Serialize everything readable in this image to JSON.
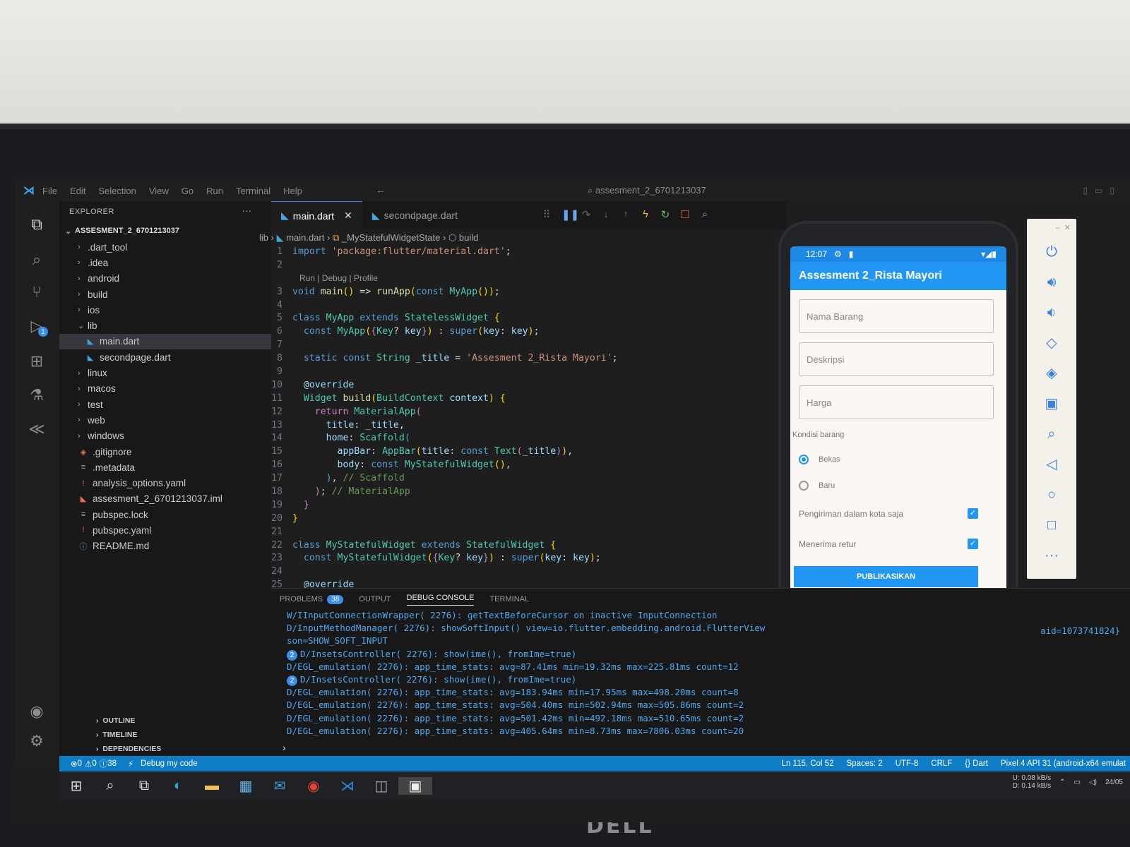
{
  "menubar": {
    "items": [
      "File",
      "Edit",
      "Selection",
      "View",
      "Go",
      "Run",
      "Terminal",
      "Help"
    ],
    "search_title": "assesment_2_6701213037"
  },
  "explorer": {
    "header": "EXPLORER",
    "project": "ASSESMENT_2_6701213037",
    "tree": [
      {
        "label": ".dart_tool",
        "type": "folder",
        "indent": 1
      },
      {
        "label": ".idea",
        "type": "folder",
        "indent": 1
      },
      {
        "label": "android",
        "type": "folder",
        "indent": 1
      },
      {
        "label": "build",
        "type": "folder",
        "indent": 1
      },
      {
        "label": "ios",
        "type": "folder",
        "indent": 1
      },
      {
        "label": "lib",
        "type": "folder-open",
        "indent": 1
      },
      {
        "label": "main.dart",
        "type": "dart",
        "indent": 2,
        "active": true
      },
      {
        "label": "secondpage.dart",
        "type": "dart",
        "indent": 2
      },
      {
        "label": "linux",
        "type": "folder",
        "indent": 1
      },
      {
        "label": "macos",
        "type": "folder",
        "indent": 1
      },
      {
        "label": "test",
        "type": "folder",
        "indent": 1
      },
      {
        "label": "web",
        "type": "folder",
        "indent": 1
      },
      {
        "label": "windows",
        "type": "folder",
        "indent": 1
      },
      {
        "label": ".gitignore",
        "type": "git",
        "indent": 1
      },
      {
        "label": ".metadata",
        "type": "lines",
        "indent": 1
      },
      {
        "label": "analysis_options.yaml",
        "type": "yaml",
        "indent": 1
      },
      {
        "label": "assesment_2_6701213037.iml",
        "type": "iml",
        "indent": 1
      },
      {
        "label": "pubspec.lock",
        "type": "lines",
        "indent": 1
      },
      {
        "label": "pubspec.yaml",
        "type": "yaml",
        "indent": 1
      },
      {
        "label": "README.md",
        "type": "info",
        "indent": 1
      }
    ],
    "outline": "OUTLINE",
    "timeline": "TIMELINE",
    "dependencies": "DEPENDENCIES"
  },
  "editor": {
    "tabs": [
      {
        "label": "main.dart",
        "active": true
      },
      {
        "label": "secondpage.dart",
        "active": false
      }
    ],
    "breadcrumb": [
      "lib",
      "main.dart",
      "_MyStatefulWidgetState",
      "build"
    ],
    "codelens": "Run | Debug | Profile",
    "lines": [
      {
        "n": "1",
        "tokens": [
          [
            "kw",
            "import "
          ],
          [
            "str",
            "'package:flutter/material.dart'"
          ],
          [
            "pl",
            ";"
          ]
        ]
      },
      {
        "n": "2",
        "tokens": []
      },
      {
        "lens": true
      },
      {
        "n": "3",
        "tokens": [
          [
            "kw",
            "void "
          ],
          [
            "fn",
            "main"
          ],
          [
            "br",
            "()"
          ],
          [
            "pl",
            " => "
          ],
          [
            "fn",
            "runApp"
          ],
          [
            "br",
            "("
          ],
          [
            "kw",
            "const "
          ],
          [
            "cls",
            "MyApp"
          ],
          [
            "br",
            "()"
          ],
          [
            "br",
            ")"
          ],
          [
            "pl",
            ";"
          ]
        ]
      },
      {
        "n": "4",
        "tokens": []
      },
      {
        "n": "5",
        "tokens": [
          [
            "kw",
            "class "
          ],
          [
            "cls",
            "MyApp "
          ],
          [
            "kw",
            "extends "
          ],
          [
            "cls",
            "StatelessWidget "
          ],
          [
            "br",
            "{"
          ]
        ]
      },
      {
        "n": "6",
        "tokens": [
          [
            "pl",
            "  "
          ],
          [
            "kw",
            "const "
          ],
          [
            "cls",
            "MyApp"
          ],
          [
            "br",
            "("
          ],
          [
            "ctl",
            "{"
          ],
          [
            "cls",
            "Key"
          ],
          [
            "pl",
            "? "
          ],
          [
            "prm",
            "key"
          ],
          [
            "ctl",
            "}"
          ],
          [
            "br",
            ")"
          ],
          [
            "pl",
            " : "
          ],
          [
            "kw",
            "super"
          ],
          [
            "br",
            "("
          ],
          [
            "prm",
            "key"
          ],
          [
            "pl",
            ": "
          ],
          [
            "prm",
            "key"
          ],
          [
            "br",
            ")"
          ],
          [
            "pl",
            ";"
          ]
        ]
      },
      {
        "n": "7",
        "tokens": []
      },
      {
        "n": "8",
        "tokens": [
          [
            "pl",
            "  "
          ],
          [
            "kw",
            "static const "
          ],
          [
            "cls",
            "String "
          ],
          [
            "prm",
            "_title"
          ],
          [
            "pl",
            " = "
          ],
          [
            "str",
            "'Assesment 2_Rista Mayori'"
          ],
          [
            "pl",
            ";"
          ]
        ]
      },
      {
        "n": "9",
        "tokens": []
      },
      {
        "n": "10",
        "tokens": [
          [
            "pl",
            "  "
          ],
          [
            "ann",
            "@override"
          ]
        ]
      },
      {
        "n": "11",
        "tokens": [
          [
            "pl",
            "  "
          ],
          [
            "cls",
            "Widget "
          ],
          [
            "fn",
            "build"
          ],
          [
            "br",
            "("
          ],
          [
            "cls",
            "BuildContext "
          ],
          [
            "prm",
            "context"
          ],
          [
            "br",
            ")"
          ],
          [
            "pl",
            " "
          ],
          [
            "br",
            "{"
          ]
        ]
      },
      {
        "n": "12",
        "tokens": [
          [
            "pl",
            "    "
          ],
          [
            "ctl",
            "return "
          ],
          [
            "cls",
            "MaterialApp"
          ],
          [
            "ctl",
            "("
          ]
        ]
      },
      {
        "n": "13",
        "tokens": [
          [
            "pl",
            "      "
          ],
          [
            "prm",
            "title"
          ],
          [
            "pl",
            ": "
          ],
          [
            "prm",
            "_title"
          ],
          [
            "pl",
            ","
          ]
        ]
      },
      {
        "n": "14",
        "tokens": [
          [
            "pl",
            "      "
          ],
          [
            "prm",
            "home"
          ],
          [
            "pl",
            ": "
          ],
          [
            "cls",
            "Scaffold"
          ],
          [
            "kw",
            "("
          ]
        ]
      },
      {
        "n": "15",
        "tokens": [
          [
            "pl",
            "        "
          ],
          [
            "prm",
            "appBar"
          ],
          [
            "pl",
            ": "
          ],
          [
            "cls",
            "AppBar"
          ],
          [
            "br",
            "("
          ],
          [
            "prm",
            "title"
          ],
          [
            "pl",
            ": "
          ],
          [
            "kw",
            "const "
          ],
          [
            "cls",
            "Text"
          ],
          [
            "ctl",
            "("
          ],
          [
            "prm",
            "_title"
          ],
          [
            "ctl",
            ")"
          ],
          [
            "br",
            ")"
          ],
          [
            "pl",
            ","
          ]
        ]
      },
      {
        "n": "16",
        "tokens": [
          [
            "pl",
            "        "
          ],
          [
            "prm",
            "body"
          ],
          [
            "pl",
            ": "
          ],
          [
            "kw",
            "const "
          ],
          [
            "cls",
            "MyStatefulWidget"
          ],
          [
            "br",
            "()"
          ],
          [
            "pl",
            ","
          ]
        ]
      },
      {
        "n": "17",
        "tokens": [
          [
            "pl",
            "      "
          ],
          [
            "kw",
            ")"
          ],
          [
            "pl",
            ", "
          ],
          [
            "cmt",
            "// Scaffold"
          ]
        ]
      },
      {
        "n": "18",
        "tokens": [
          [
            "pl",
            "    "
          ],
          [
            "ctl",
            ")"
          ],
          [
            "pl",
            "; "
          ],
          [
            "cmt",
            "// MaterialApp"
          ]
        ]
      },
      {
        "n": "19",
        "tokens": [
          [
            "pl",
            "  "
          ],
          [
            "ctl",
            "}"
          ]
        ]
      },
      {
        "n": "20",
        "tokens": [
          [
            "br",
            "}"
          ]
        ]
      },
      {
        "n": "21",
        "tokens": []
      },
      {
        "n": "22",
        "tokens": [
          [
            "kw",
            "class "
          ],
          [
            "cls",
            "MyStatefulWidget "
          ],
          [
            "kw",
            "extends "
          ],
          [
            "cls",
            "StatefulWidget "
          ],
          [
            "br",
            "{"
          ]
        ]
      },
      {
        "n": "23",
        "tokens": [
          [
            "pl",
            "  "
          ],
          [
            "kw",
            "const "
          ],
          [
            "cls",
            "MyStatefulWidget"
          ],
          [
            "br",
            "("
          ],
          [
            "ctl",
            "{"
          ],
          [
            "cls",
            "Key"
          ],
          [
            "pl",
            "? "
          ],
          [
            "prm",
            "key"
          ],
          [
            "ctl",
            "}"
          ],
          [
            "br",
            ")"
          ],
          [
            "pl",
            " : "
          ],
          [
            "kw",
            "super"
          ],
          [
            "br",
            "("
          ],
          [
            "prm",
            "key"
          ],
          [
            "pl",
            ": "
          ],
          [
            "prm",
            "key"
          ],
          [
            "br",
            ")"
          ],
          [
            "pl",
            ";"
          ]
        ]
      },
      {
        "n": "24",
        "tokens": []
      },
      {
        "n": "25",
        "tokens": [
          [
            "pl",
            "  "
          ],
          [
            "ann",
            "@override"
          ]
        ]
      }
    ]
  },
  "panel": {
    "tabs": [
      "PROBLEMS",
      "OUTPUT",
      "DEBUG CONSOLE",
      "TERMINAL"
    ],
    "problems_count": "38",
    "console": [
      {
        "text": "W/IInputConnectionWrapper( 2276): getTextBeforeCursor on inactive InputConnection"
      },
      {
        "text": "D/InputMethodManager( 2276): showSoftInput() view=io.flutter.embedding.android.FlutterView"
      },
      {
        "text": "son=SHOW_SOFT_INPUT"
      },
      {
        "rep": "2",
        "text": "D/InsetsController( 2276): show(ime(), fromIme=true)"
      },
      {
        "text": "D/EGL_emulation( 2276): app_time_stats: avg=87.41ms min=19.32ms max=225.81ms count=12"
      },
      {
        "rep": "2",
        "text": "D/InsetsController( 2276): show(ime(), fromIme=true)"
      },
      {
        "text": "D/EGL_emulation( 2276): app_time_stats: avg=183.94ms min=17.95ms max=498.20ms count=8"
      },
      {
        "text": "D/EGL_emulation( 2276): app_time_stats: avg=504.40ms min=502.94ms max=505.86ms count=2"
      },
      {
        "text": "D/EGL_emulation( 2276): app_time_stats: avg=501.42ms min=492.18ms max=510.65ms count=2"
      },
      {
        "text": "D/EGL_emulation( 2276): app_time_stats: avg=405.64ms min=8.73ms max=7806.03ms count=20"
      }
    ],
    "console_right": "aid=1073741824}"
  },
  "statusbar": {
    "errors": "0",
    "warnings": "0",
    "infos": "38",
    "debug": "Debug my code",
    "position": "Ln 115, Col 52",
    "spaces": "Spaces: 2",
    "encoding": "UTF-8",
    "eol": "CRLF",
    "language": "Dart",
    "device": "Pixel 4 API 31 (android-x64 emulat"
  },
  "tray": {
    "net_up": "0.08 kB/s",
    "net_down": "0.14 kB/s",
    "date": "24/05"
  },
  "phone": {
    "time": "12:07",
    "app_title": "Assesment 2_Rista Mayori",
    "fields": [
      "Nama Barang",
      "Deskripsi",
      "Harga"
    ],
    "section_label": "Kondisi barang",
    "radios": [
      {
        "label": "Bekas",
        "selected": true
      },
      {
        "label": "Baru",
        "selected": false
      }
    ],
    "checks": [
      {
        "label": "Pengiriman dalam kota saja",
        "checked": true
      },
      {
        "label": "Menerima retur",
        "checked": true
      }
    ],
    "button": "PUBLIKASIKAN"
  },
  "monitor_brand": "DELL",
  "colors": {
    "accent": "#3b8eea",
    "statusbar": "#0f7cc6",
    "appbar": "#2196f3"
  }
}
